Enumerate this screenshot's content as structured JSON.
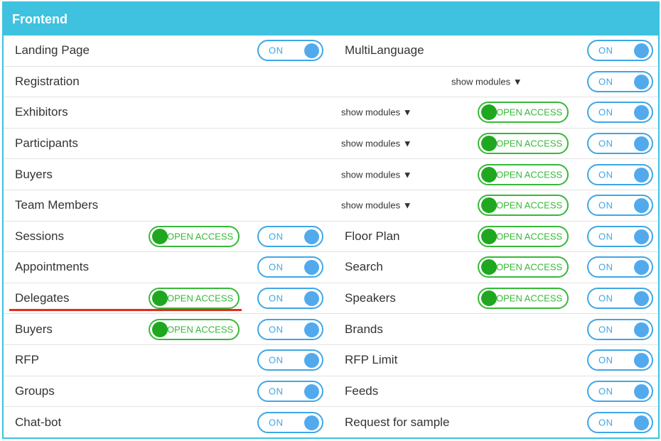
{
  "panel": {
    "title": "Frontend"
  },
  "toggle_text": "ON",
  "open_access_text": "OPEN ACCESS",
  "show_modules_text": "show modules ▼",
  "rows": [
    {
      "left": "Landing Page",
      "right": "MultiLanguage"
    },
    {
      "left": "Registration"
    },
    {
      "left": "Exhibitors"
    },
    {
      "left": "Participants"
    },
    {
      "left": "Buyers"
    },
    {
      "left": "Team Members"
    },
    {
      "left": "Sessions",
      "right": "Floor Plan"
    },
    {
      "left": "Appointments",
      "right": "Search"
    },
    {
      "left": "Delegates",
      "right": "Speakers"
    },
    {
      "left": "Buyers",
      "right": "Brands"
    },
    {
      "left": "RFP",
      "right": "RFP Limit"
    },
    {
      "left": "Groups",
      "right": "Feeds"
    },
    {
      "left": "Chat-bot",
      "right": "Request for sample"
    }
  ],
  "colors": {
    "header": "#3ec2df",
    "toggle_blue": "#3ea7e6",
    "open_access_green": "#37b938",
    "annotation_red": "#e8291c"
  }
}
